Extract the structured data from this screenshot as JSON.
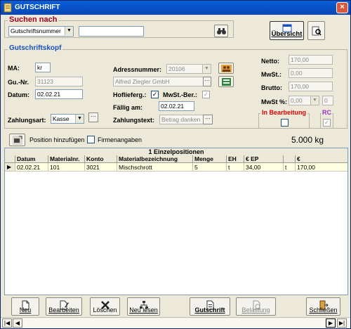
{
  "window": {
    "title": "GUTSCHRIFT",
    "close": "×"
  },
  "search": {
    "title": "Suchen nach",
    "mode": "Gutschriftsnummer",
    "value": ""
  },
  "buttons": {
    "uebersicht": "Übersicht"
  },
  "header": {
    "title": "Gutschriftskopf",
    "ma_label": "MA:",
    "ma": "kr",
    "gu_label": "Gu.-Nr.",
    "gu": "31123",
    "datum_label": "Datum:",
    "datum": "02.02.21",
    "zahlungsart_label": "Zahlungsart:",
    "zahlungsart": "Kasse",
    "adressnummer_label": "Adressnummer:",
    "adressnummer": "20106",
    "adresse": "Alfred Ziegler GmbH",
    "hoflieferg_label": "Hoflieferg.:",
    "hoflieferg": "✓",
    "mwst_ber_label": "MwSt.-Ber.:",
    "mwst_ber": "✓",
    "faellig_label": "Fällig am:",
    "faellig": "02.02.21",
    "zahlungstext_label": "Zahlungstext:",
    "zahlungstext": "Betrag danken",
    "netto_label": "Netto:",
    "netto": "170,00",
    "mwst_label": "MwSt.:",
    "mwst": "0,00",
    "brutto_label": "Brutto:",
    "brutto": "170,00",
    "mwst_pct_label": "MwSt %:",
    "mwst_pct": "0,00",
    "mwst_pct2": "0",
    "in_bearbeitung": "In Bearbeitung",
    "rc": "RC",
    "rc_check": "✓"
  },
  "position": {
    "add": "Position hinzufügen",
    "firmenangaben": "Firmenangaben",
    "weight": "5.000 kg"
  },
  "grid": {
    "caption": "1  Einzelpositionen",
    "columns": [
      "Datum",
      "Materialnr.",
      "Konto",
      "Materialbezeichnung",
      "Menge",
      "EH",
      "€ EP",
      "",
      "€"
    ],
    "row": [
      "02.02.21",
      "101",
      "3021",
      "Mischschrott",
      "5",
      "t",
      "34,00",
      "t",
      "170,00"
    ],
    "row_marker": "▶"
  },
  "toolbar": {
    "neu": "Neu",
    "bearbeiten": "Bearbeiten",
    "loeschen": "Löschen",
    "neu_lesen": "Neu lesen",
    "gutschrift": "Gutschrift",
    "belastung": "Belastung",
    "schliessen": "Schließen"
  },
  "scroll": {
    "first": "|◀",
    "prev": "◀",
    "next": "▶",
    "last": "▶|"
  },
  "colors": {
    "title_red": "#a0001e",
    "title_blue": "#1750c4",
    "status_red": "#e00000",
    "rc_purple": "#9b30c8",
    "row_yellow": "#ffffe1"
  }
}
